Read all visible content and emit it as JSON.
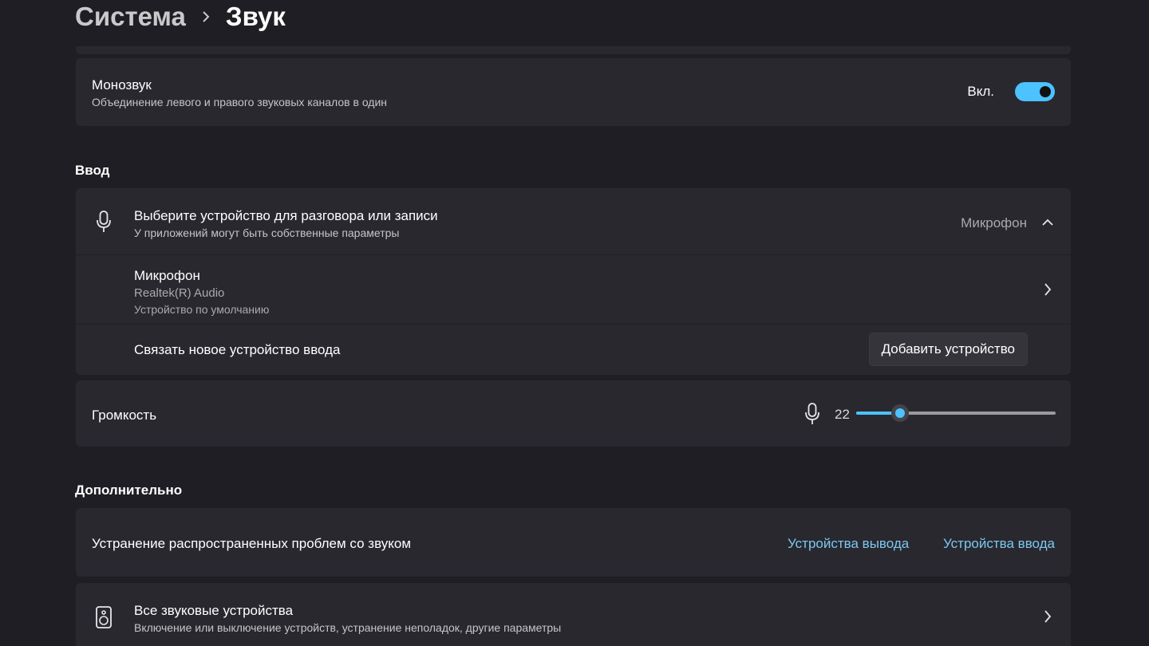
{
  "breadcrumb": {
    "parent": "Система",
    "current": "Звук"
  },
  "mono_audio": {
    "title": "Монозвук",
    "subtitle": "Объединение левого и правого звуковых каналов в один",
    "state_label": "Вкл.",
    "enabled": true
  },
  "input_section": {
    "title": "Ввод",
    "choose_device": {
      "title": "Выберите устройство для разговора или записи",
      "subtitle": "У приложений могут быть собственные параметры",
      "selected": "Микрофон"
    },
    "device": {
      "name": "Микрофон",
      "driver": "Realtek(R) Audio",
      "status": "Устройство по умолчанию"
    },
    "pair": {
      "label": "Связать новое устройство ввода",
      "button": "Добавить устройство"
    },
    "volume": {
      "label": "Громкость",
      "value": "22",
      "level": 22
    }
  },
  "advanced_section": {
    "title": "Дополнительно",
    "troubleshoot": {
      "label": "Устранение распространенных проблем со звуком",
      "link_output": "Устройства вывода",
      "link_input": "Устройства ввода"
    },
    "all_devices": {
      "title": "Все звуковые устройства",
      "subtitle": "Включение или выключение устройств, устранение неполадок, другие параметры"
    }
  },
  "icons": {
    "breadcrumb_sep": "chevron-right-icon",
    "microphone": "microphone-icon",
    "expand": "chevron-up-icon",
    "navigate": "chevron-right-icon",
    "speaker": "speaker-icon"
  },
  "colors": {
    "accent": "#4cc2ff",
    "link": "#7cc8f0",
    "card": "#29282f",
    "background": "#1f1e24"
  }
}
